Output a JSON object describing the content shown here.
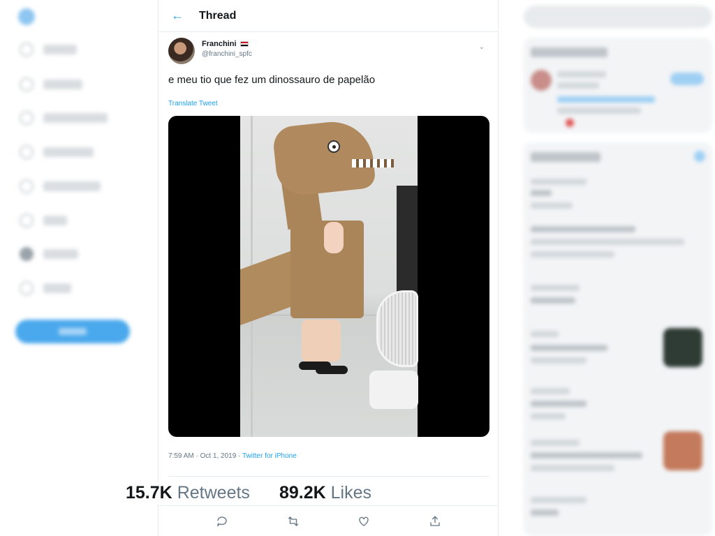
{
  "header": {
    "back_icon": "←",
    "title": "Thread"
  },
  "tweet": {
    "author_name": "Franchini",
    "author_handle": "@franchini_spfc",
    "caret_icon": "⌄",
    "text": "e meu tio que fez um dinossauro de papelão",
    "translate_label": "Translate Tweet",
    "time_date": "7:59 AM · Oct 1, 2019 · ",
    "source": "Twitter for iPhone",
    "retweets_count": "15.7K",
    "retweets_label": "Retweets",
    "likes_count": "89.2K",
    "likes_label": "Likes"
  },
  "actions": [
    {
      "icon": "reply-icon"
    },
    {
      "icon": "retweet-icon"
    },
    {
      "icon": "like-icon"
    },
    {
      "icon": "share-icon"
    }
  ],
  "colors": {
    "accent": "#1da1f2",
    "muted": "#657786",
    "border": "#e6ecf0"
  }
}
